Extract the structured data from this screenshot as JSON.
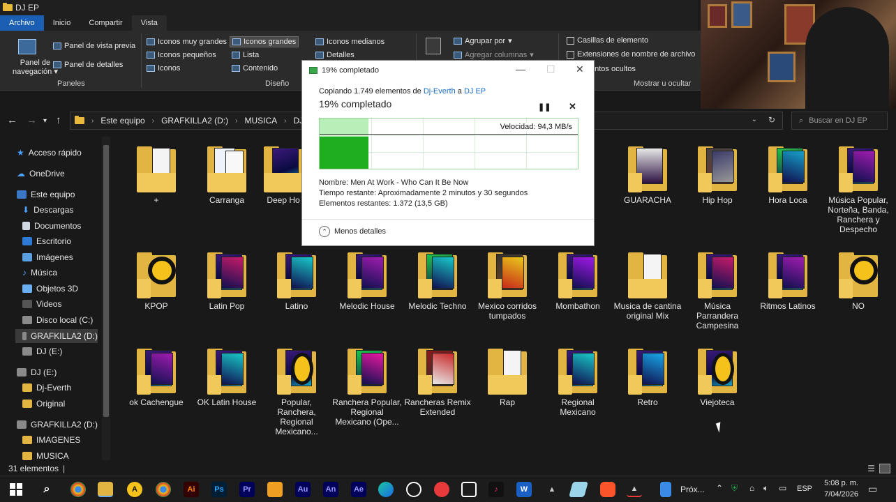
{
  "window": {
    "title": "DJ EP"
  },
  "menu": {
    "tabs": [
      "Archivo",
      "Inicio",
      "Compartir",
      "Vista"
    ]
  },
  "ribbon": {
    "panes": {
      "nav_pane_line1": "Panel de",
      "nav_pane_line2": "navegación",
      "preview_pane": "Panel de vista previa",
      "details_pane": "Panel de detalles",
      "group_label": "Paneles"
    },
    "layout": {
      "very_large": "Iconos muy grandes",
      "large": "Iconos grandes",
      "medium": "Iconos medianos",
      "small": "Iconos pequeños",
      "list": "Lista",
      "details": "Detalles",
      "icons": "Iconos",
      "content": "Contenido",
      "group_label": "Diseño"
    },
    "current_view": {
      "group_by": "Agrupar por",
      "add_columns": "Agregar columnas"
    },
    "show_hide": {
      "item_checkboxes": "Casillas de elemento",
      "file_extensions": "Extensiones de nombre de archivo",
      "hidden_items": "entos ocultos",
      "group_label": "Mostrar u ocultar"
    }
  },
  "address": {
    "crumbs": [
      "Este equipo",
      "GRAFKILLA2 (D:)",
      "MUSICA",
      "DJ EP"
    ],
    "search_placeholder": "Buscar en DJ EP"
  },
  "sidebar": {
    "items": [
      "Acceso rápido",
      "OneDrive",
      "Este equipo",
      "Descargas",
      "Documentos",
      "Escritorio",
      "Imágenes",
      "Música",
      "Objetos 3D",
      "Videos",
      "Disco local (C:)",
      "GRAFKILLA2 (D:)",
      "DJ (E:)",
      "DJ (E:)",
      "Dj-Everth",
      "Original",
      "GRAFKILLA2 (D:)",
      "IMAGENES",
      "MUSICA"
    ]
  },
  "folders": {
    "row1": [
      "+",
      "Carranga",
      "Deep Ho",
      "GUARACHA",
      "Hip Hop",
      "Hora Loca",
      "Música Popular, Norteña, Banda, Ranchera y Despecho"
    ],
    "row2": [
      "KPOP",
      "Latin Pop",
      "Latino",
      "Melodic House",
      "Melodic Techno",
      "Mexico corridos tumpados",
      "Mombathon",
      "Musica de cantina original Mix",
      "Música Parrandera Campesina",
      "Ritmos Latinos",
      "NO"
    ],
    "row3": [
      "ok Cachengue",
      "OK Latin House",
      "Popular, Ranchera, Regional Mexicano...",
      "Ranchera Popular, Regional Mexicano (Ope...",
      "Rancheras Remix Extended",
      "Rap",
      "Regional Mexicano",
      "Retro",
      "Viejoteca"
    ]
  },
  "status": {
    "count": "31 elementos"
  },
  "dialog": {
    "title": "19% completado",
    "copying_prefix": "Copiando 1.749 elementos de",
    "source": "Dj-Everth",
    "to_word": "a",
    "dest": "DJ EP",
    "percent_text": "19% completado",
    "progress": 0.19,
    "speed": "Velocidad: 94,3 MB/s",
    "name_line": "Nombre:  Men At Work - Who Can It Be Now",
    "time_line": "Tiempo restante:  Aproximadamente 2 minutos y 30 segundos",
    "remaining_line": "Elementos restantes:  1.372 (13,5 GB)",
    "less_details": "Menos detalles"
  },
  "taskbar": {
    "ps_label": "Ps",
    "pr_label": "Pr",
    "ai_label": "Ai",
    "au_label": "Au",
    "an_label": "An",
    "ae_label": "Ae",
    "w_label": "W",
    "next_label": "Próx...",
    "lang": "ESP",
    "time": "5:08 p. m.",
    "date": "7/04/2026"
  },
  "colors": {
    "accent": "#1a5fb4",
    "folder": "#e2b441",
    "progress_green": "#1fae1f",
    "link": "#1a6fc4"
  }
}
